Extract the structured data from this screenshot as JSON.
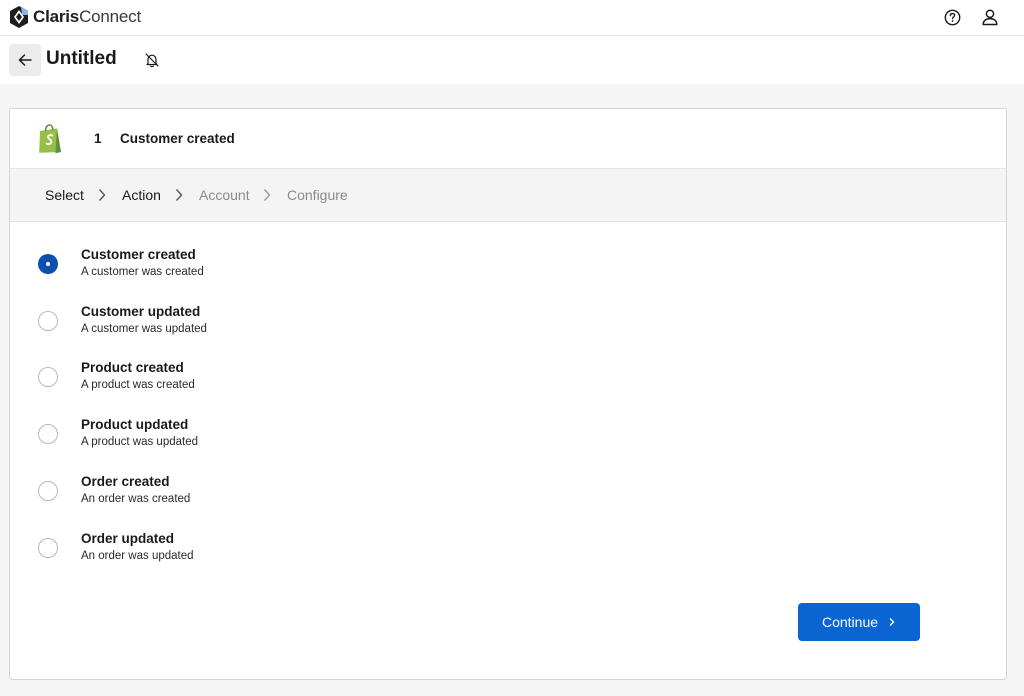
{
  "app": {
    "brand_bold": "Claris",
    "brand_regular": "Connect"
  },
  "topbar": {
    "help_icon": "help-circle-icon",
    "user_icon": "user-icon"
  },
  "flow": {
    "title": "Untitled",
    "back_icon": "arrow-left-icon",
    "notifications_icon": "bell-off-icon"
  },
  "step": {
    "app_icon": "shopify-icon",
    "number": "1",
    "name": "Customer created"
  },
  "breadcrumbs": [
    {
      "label": "Select",
      "state": "active"
    },
    {
      "label": "Action",
      "state": "active"
    },
    {
      "label": "Account",
      "state": "inactive"
    },
    {
      "label": "Configure",
      "state": "inactive"
    }
  ],
  "options": [
    {
      "title": "Customer created",
      "description": "A customer was created",
      "selected": true
    },
    {
      "title": "Customer updated",
      "description": "A customer was updated",
      "selected": false
    },
    {
      "title": "Product created",
      "description": "A product was created",
      "selected": false
    },
    {
      "title": "Product updated",
      "description": "A product was updated",
      "selected": false
    },
    {
      "title": "Order created",
      "description": "An order was created",
      "selected": false
    },
    {
      "title": "Order updated",
      "description": "An order was updated",
      "selected": false
    }
  ],
  "actions": {
    "continue_label": "Continue",
    "continue_icon": "chevron-right-icon"
  },
  "colors": {
    "primary": "#0a64d1",
    "radio_selected": "#0d4fae",
    "shopify_green": "#95bf47"
  }
}
